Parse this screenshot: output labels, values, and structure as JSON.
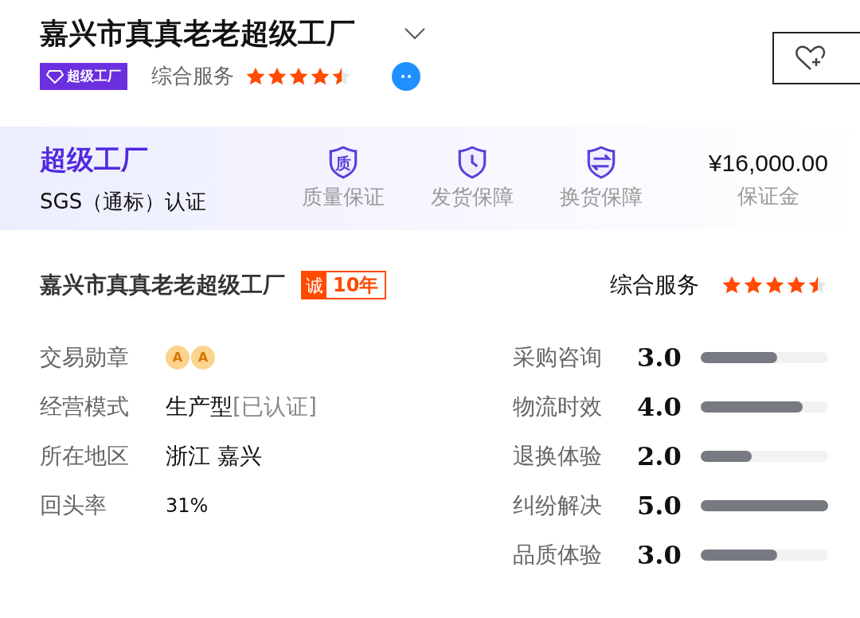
{
  "header": {
    "title": "嘉兴市真真老老超级工厂",
    "badge": "超级工厂",
    "service_label": "综合服务",
    "stars": 4.5
  },
  "guarantee_band": {
    "title": "超级工厂",
    "certification": "SGS（通标）认证",
    "items": [
      {
        "kind": "quality",
        "icon_text": "质",
        "label": "质量保证"
      },
      {
        "kind": "shipping",
        "label": "发货保障"
      },
      {
        "kind": "exchange",
        "label": "换货保障"
      }
    ],
    "deposit": {
      "amount": "¥16,000.00",
      "label": "保证金"
    }
  },
  "profile": {
    "name": "嘉兴市真真老老超级工厂",
    "cheng": "诚",
    "years": "10年",
    "service_label": "综合服务",
    "stars": 4.5,
    "info": [
      {
        "kind": "medals",
        "label": "交易勋章",
        "medals": [
          "A",
          "A"
        ]
      },
      {
        "kind": "text",
        "label": "经营模式",
        "value": "生产型",
        "note": "[已认证]"
      },
      {
        "kind": "text",
        "label": "所在地区",
        "value": "浙江 嘉兴"
      },
      {
        "kind": "small",
        "label": "回头率",
        "value": "31%"
      }
    ],
    "ratings": [
      {
        "label": "采购咨询",
        "score": "3.0",
        "level": 0.6
      },
      {
        "label": "物流时效",
        "score": "4.0",
        "level": 0.8
      },
      {
        "label": "退换体验",
        "score": "2.0",
        "level": 0.4
      },
      {
        "label": "纠纷解决",
        "score": "5.0",
        "level": 1.0
      },
      {
        "label": "品质体验",
        "score": "3.0",
        "level": 0.6
      }
    ]
  }
}
